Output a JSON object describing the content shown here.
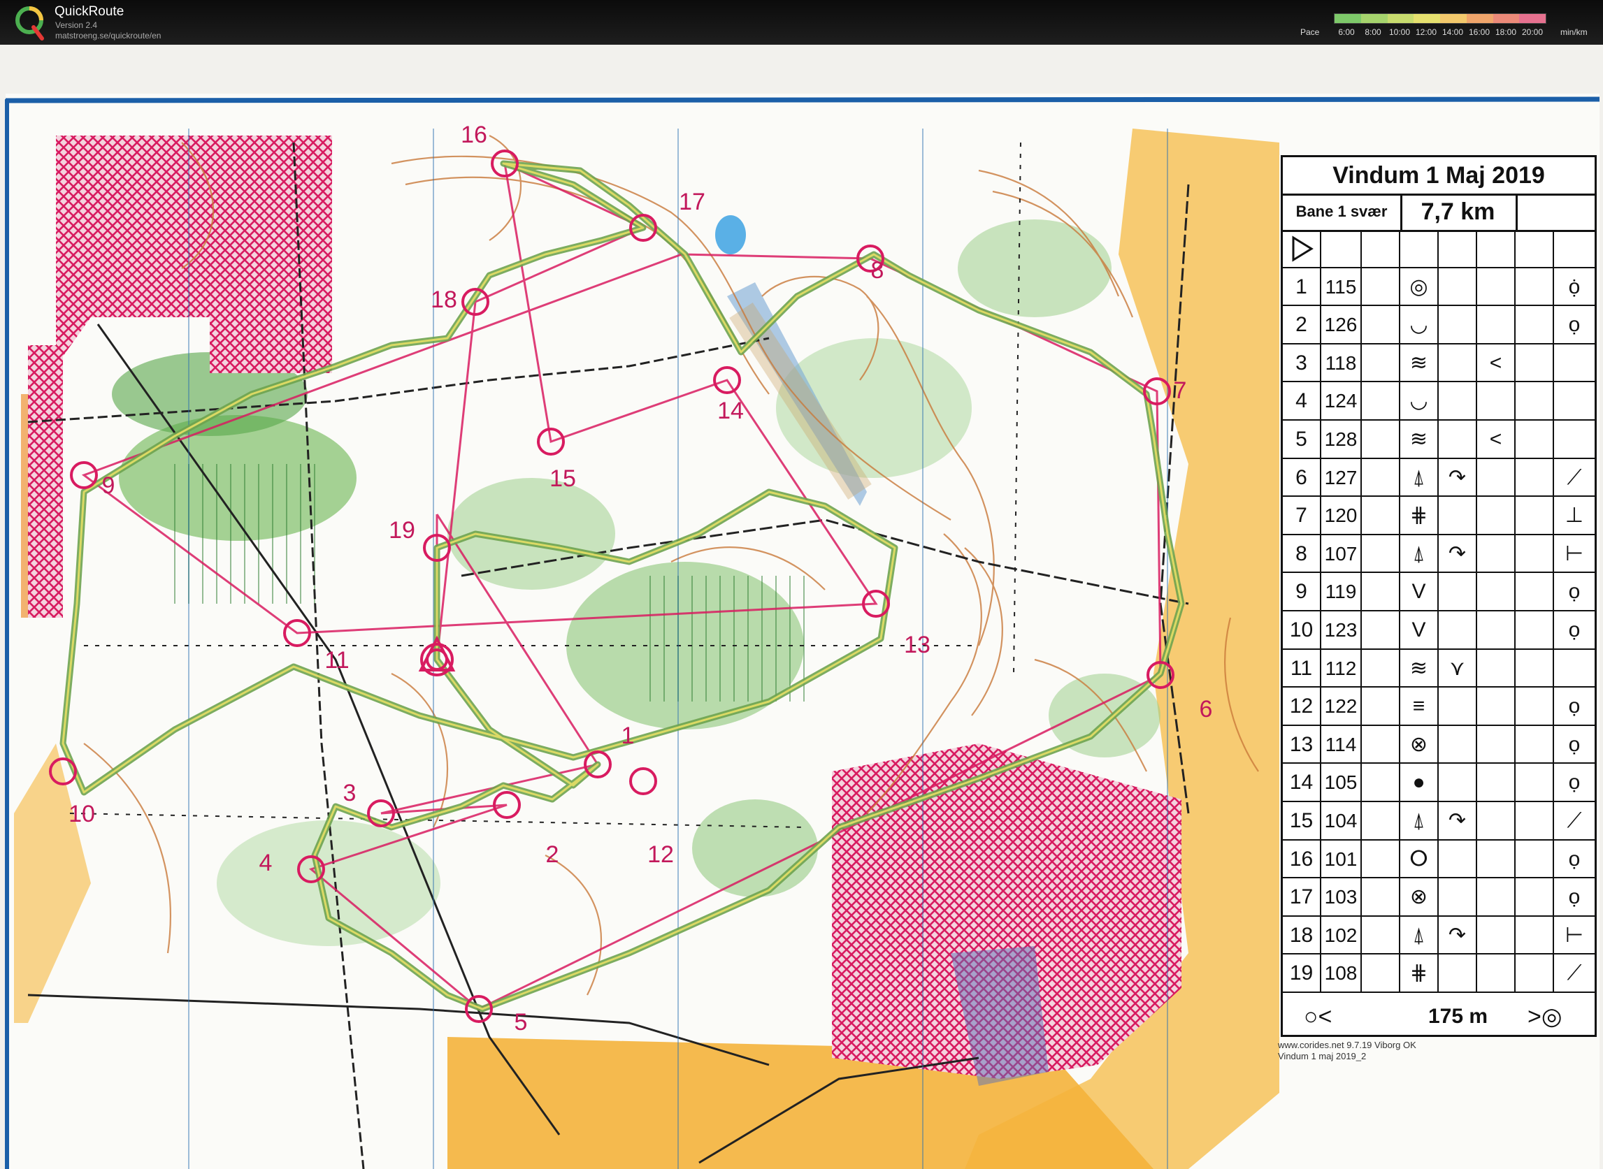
{
  "app": {
    "title": "QuickRoute",
    "version": "Version 2.4",
    "url": "matstroeng.se/quickroute/en",
    "logo_letter": "Q"
  },
  "pace_scale": {
    "label": "Pace",
    "unit": "min/km",
    "ticks": [
      "6:00",
      "8:00",
      "10:00",
      "12:00",
      "14:00",
      "16:00",
      "18:00",
      "20:00"
    ],
    "colors": [
      "#7ec96a",
      "#a6d46d",
      "#c8dc6e",
      "#e6e16f",
      "#f3c96c",
      "#f0a56b",
      "#ec8a79",
      "#e6718f"
    ]
  },
  "control_description": {
    "title": "Vindum 1 Maj 2019",
    "course": "Bane 1 svær",
    "length": "7,7 km",
    "start_symbol": "triangle-icon",
    "rows": [
      {
        "num": "1",
        "code": "115",
        "c": "",
        "d": "◎",
        "e": "",
        "f": "",
        "h": "ọ̇"
      },
      {
        "num": "2",
        "code": "126",
        "c": "",
        "d": "◡",
        "e": "",
        "f": "",
        "h": "ọ"
      },
      {
        "num": "3",
        "code": "118",
        "c": "",
        "d": "≋",
        "e": "",
        "f": "<",
        "h": ""
      },
      {
        "num": "4",
        "code": "124",
        "c": "",
        "d": "◡",
        "e": "",
        "f": "",
        "h": ""
      },
      {
        "num": "5",
        "code": "128",
        "c": "",
        "d": "≋",
        "e": "",
        "f": "<",
        "h": ""
      },
      {
        "num": "6",
        "code": "127",
        "c": "",
        "d": "⍋",
        "e": "↷",
        "f": "",
        "h": "⟋"
      },
      {
        "num": "7",
        "code": "120",
        "c": "",
        "d": "⋕",
        "e": "",
        "f": "",
        "h": "⊥"
      },
      {
        "num": "8",
        "code": "107",
        "c": "",
        "d": "⍋",
        "e": "↷",
        "f": "",
        "h": "⊢"
      },
      {
        "num": "9",
        "code": "119",
        "c": "",
        "d": "V",
        "e": "",
        "f": "",
        "h": "ọ"
      },
      {
        "num": "10",
        "code": "123",
        "c": "",
        "d": "V",
        "e": "",
        "f": "",
        "h": "ọ"
      },
      {
        "num": "11",
        "code": "112",
        "c": "",
        "d": "≋",
        "e": "⋎",
        "f": "",
        "h": ""
      },
      {
        "num": "12",
        "code": "122",
        "c": "",
        "d": "≡",
        "e": "",
        "f": "",
        "h": "ọ"
      },
      {
        "num": "13",
        "code": "114",
        "c": "",
        "d": "⊗",
        "e": "",
        "f": "",
        "h": "ọ"
      },
      {
        "num": "14",
        "code": "105",
        "c": "",
        "d": "●",
        "e": "",
        "f": "",
        "h": "ọ"
      },
      {
        "num": "15",
        "code": "104",
        "c": "",
        "d": "⍋",
        "e": "↷",
        "f": "",
        "h": "⟋"
      },
      {
        "num": "16",
        "code": "101",
        "c": "",
        "d": "ⵔ",
        "e": "",
        "f": "",
        "h": "ọ"
      },
      {
        "num": "17",
        "code": "103",
        "c": "",
        "d": "⊗",
        "e": "",
        "f": "",
        "h": "ọ"
      },
      {
        "num": "18",
        "code": "102",
        "c": "",
        "d": "⍋",
        "e": "↷",
        "f": "",
        "h": "⊢"
      },
      {
        "num": "19",
        "code": "108",
        "c": "",
        "d": "⋕",
        "e": "",
        "f": "",
        "h": "⟋"
      }
    ],
    "finish_start": "○<",
    "finish_distance": "175 m",
    "finish_end": ">◎"
  },
  "imprint": {
    "line1": "www.corides.net 9.7.19 Viborg OK",
    "line2": "Vindum 1 maj 2019_2"
  },
  "controls": [
    {
      "label": "1"
    },
    {
      "label": "2"
    },
    {
      "label": "3"
    },
    {
      "label": "4"
    },
    {
      "label": "5"
    },
    {
      "label": "6"
    },
    {
      "label": "7"
    },
    {
      "label": "8"
    },
    {
      "label": "9"
    },
    {
      "label": "10"
    },
    {
      "label": "11"
    },
    {
      "label": "12"
    },
    {
      "label": "13"
    },
    {
      "label": "14"
    },
    {
      "label": "15"
    },
    {
      "label": "16"
    },
    {
      "label": "17"
    },
    {
      "label": "18"
    },
    {
      "label": "19"
    }
  ]
}
